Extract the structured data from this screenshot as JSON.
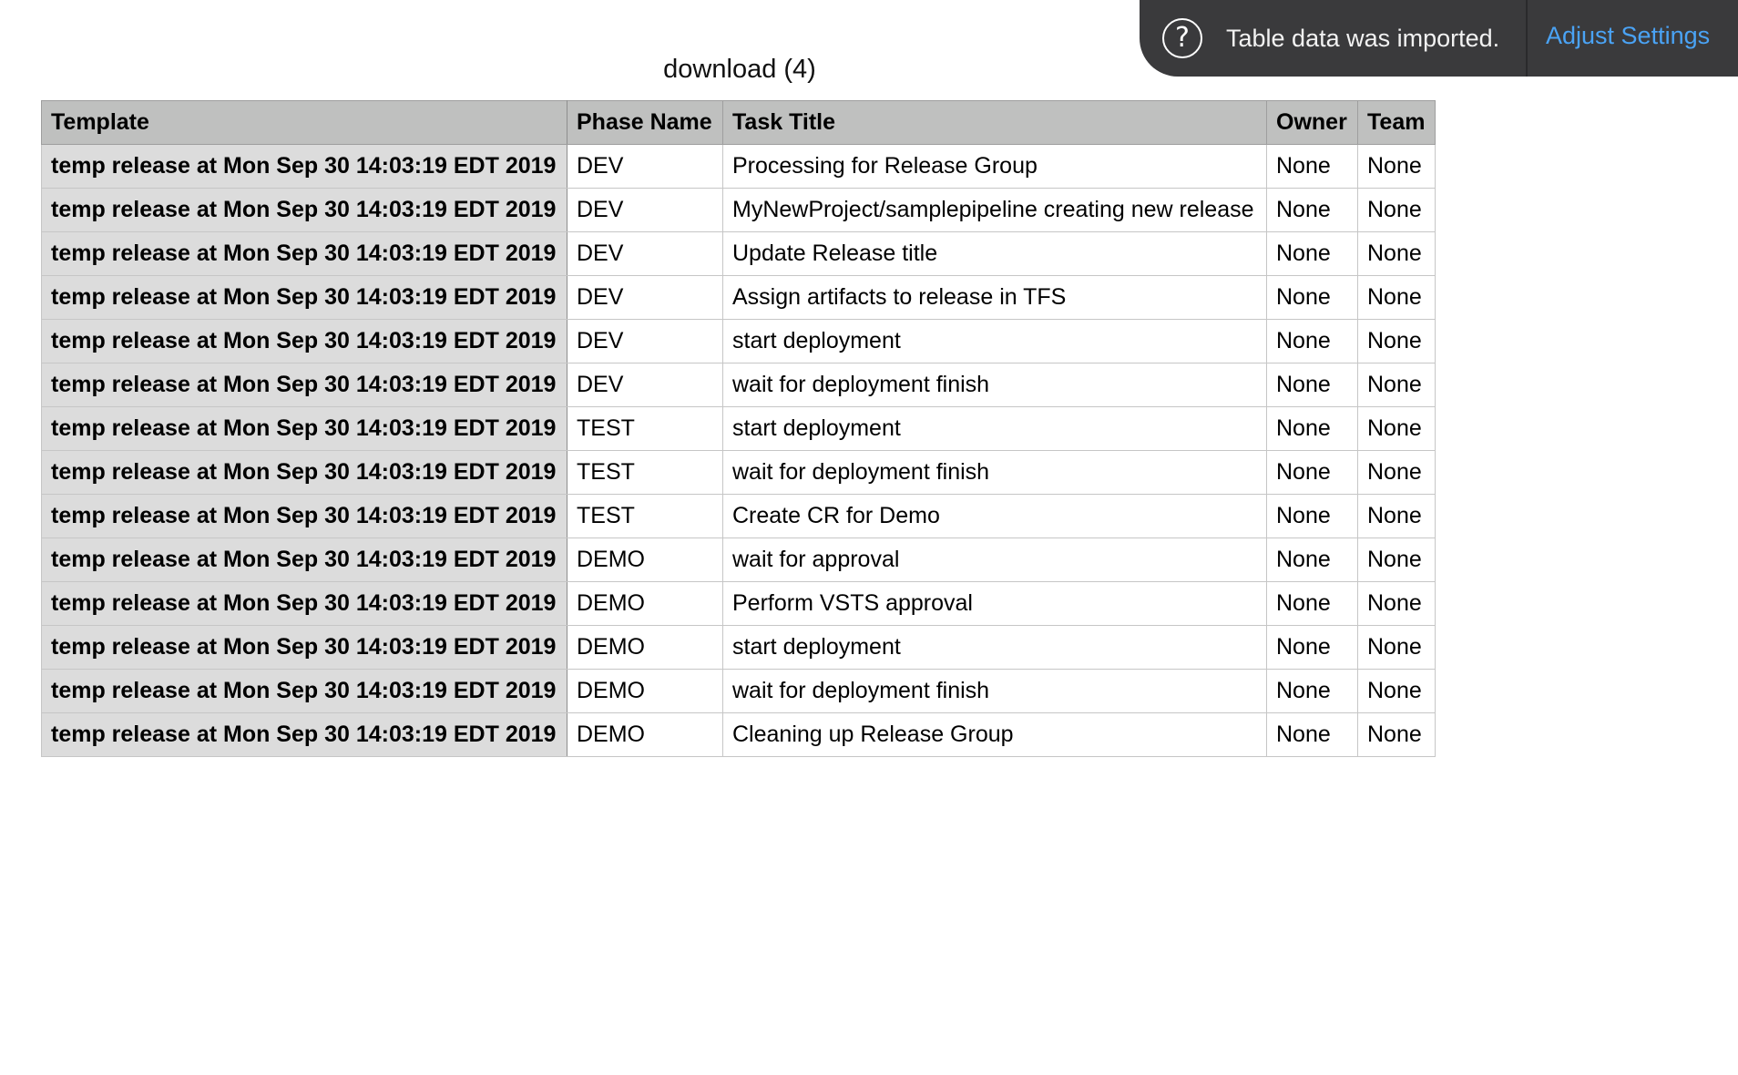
{
  "sheet": {
    "title": "download (4)"
  },
  "table": {
    "columns": [
      "Template",
      "Phase Name",
      "Task Title",
      "Owner",
      "Team"
    ],
    "rows": [
      [
        "temp release at Mon Sep 30 14:03:19 EDT 2019",
        "DEV",
        "Processing for Release Group",
        "None",
        "None"
      ],
      [
        "temp release at Mon Sep 30 14:03:19 EDT 2019",
        "DEV",
        "MyNewProject/samplepipeline creating new release",
        "None",
        "None"
      ],
      [
        "temp release at Mon Sep 30 14:03:19 EDT 2019",
        "DEV",
        "Update Release title",
        "None",
        "None"
      ],
      [
        "temp release at Mon Sep 30 14:03:19 EDT 2019",
        "DEV",
        "Assign artifacts to release in TFS",
        "None",
        "None"
      ],
      [
        "temp release at Mon Sep 30 14:03:19 EDT 2019",
        "DEV",
        "start deployment",
        "None",
        "None"
      ],
      [
        "temp release at Mon Sep 30 14:03:19 EDT 2019",
        "DEV",
        "wait for deployment finish",
        "None",
        "None"
      ],
      [
        "temp release at Mon Sep 30 14:03:19 EDT 2019",
        "TEST",
        "start deployment",
        "None",
        "None"
      ],
      [
        "temp release at Mon Sep 30 14:03:19 EDT 2019",
        "TEST",
        "wait for deployment finish",
        "None",
        "None"
      ],
      [
        "temp release at Mon Sep 30 14:03:19 EDT 2019",
        "TEST",
        "Create CR for Demo",
        "None",
        "None"
      ],
      [
        "temp release at Mon Sep 30 14:03:19 EDT 2019",
        "DEMO",
        "wait for approval",
        "None",
        "None"
      ],
      [
        "temp release at Mon Sep 30 14:03:19 EDT 2019",
        "DEMO",
        "Perform VSTS approval",
        "None",
        "None"
      ],
      [
        "temp release at Mon Sep 30 14:03:19 EDT 2019",
        "DEMO",
        "start deployment",
        "None",
        "None"
      ],
      [
        "temp release at Mon Sep 30 14:03:19 EDT 2019",
        "DEMO",
        "wait for deployment finish",
        "None",
        "None"
      ],
      [
        "temp release at Mon Sep 30 14:03:19 EDT 2019",
        "DEMO",
        "Cleaning up Release Group",
        "None",
        "None"
      ]
    ]
  },
  "toast": {
    "icon": "question-circle-icon",
    "message": "Table data was imported.",
    "action_label": "Adjust Settings",
    "action_color": "#4aa3f5",
    "background_color": "#3a3a3c"
  },
  "colors": {
    "header_bg": "#bfc0bf",
    "header_column_bg": "#dcdcdc",
    "grid_line": "#c6c6c6"
  }
}
